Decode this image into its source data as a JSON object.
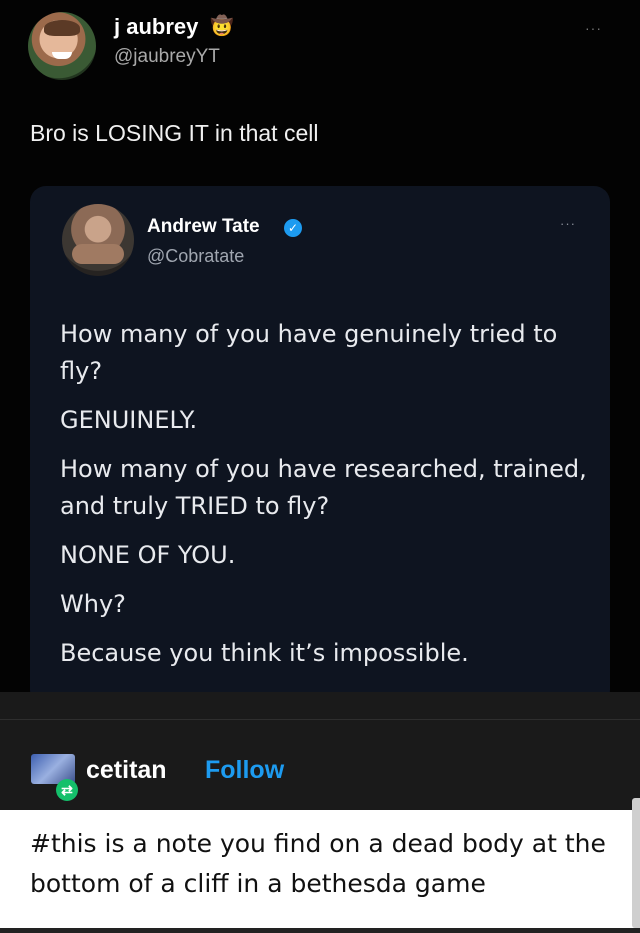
{
  "tweet": {
    "display_name": "j aubrey",
    "badge_emoji": "🤠",
    "handle": "@jaubreyYT",
    "more_label": "···",
    "text": "Bro is LOSING IT in that cell"
  },
  "quoted_tweet": {
    "display_name": "Andrew Tate",
    "verified_mark": "✓",
    "handle": "@Cobratate",
    "more_label": "···",
    "lines": [
      "How many of you have genuinely tried to fly?",
      "GENUINELY.",
      "How many of you have researched, trained, and truly TRIED to fly?",
      "NONE OF YOU.",
      "Why?",
      "Because you think it’s impossible."
    ]
  },
  "tumblr": {
    "username": "cetitan",
    "follow_label": "Follow",
    "reblog_icon": "⇄",
    "note": "#this is a note you find on a dead body at the bottom of a cliff in a bethesda game"
  },
  "colors": {
    "follow": "#1d9bf0",
    "verified": "#1d9bf0",
    "reblog": "#14c06b"
  }
}
